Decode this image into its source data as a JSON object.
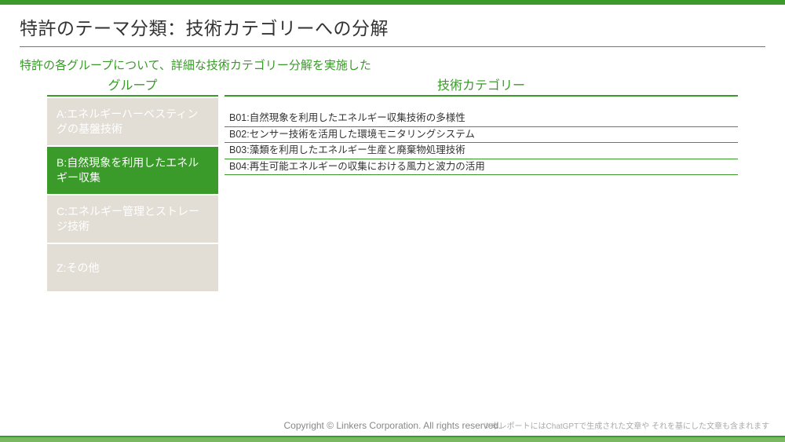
{
  "title": "特許のテーマ分類：技術カテゴリーへの分解",
  "subtitle": "特許の各グループについて、詳細な技術カテゴリー分解を実施した",
  "columns": {
    "left": "グループ",
    "right": "技術カテゴリー"
  },
  "groups": [
    {
      "label": "A:エネルギーハーベスティングの基盤技術",
      "active": false
    },
    {
      "label": "B:自然現象を利用したエネルギー収集",
      "active": true
    },
    {
      "label": "C:エネルギー管理とストレージ技術",
      "active": false
    },
    {
      "label": "Z:その他",
      "active": false
    }
  ],
  "tech_categories": [
    "B01:自然現象を利用したエネルギー収集技術の多様性",
    "B02:センサー技術を活用した環境モニタリングシステム",
    "B03:藻類を利用したエネルギー生産と廃棄物処理技術",
    "B04:再生可能エネルギーの収集における風力と波力の活用"
  ],
  "footer": {
    "copyright": "Copyright © Linkers Corporation. All rights reserved.",
    "note": "※本レポートにはChatGPTで生成された文章や それを基にした文章も含まれます"
  }
}
